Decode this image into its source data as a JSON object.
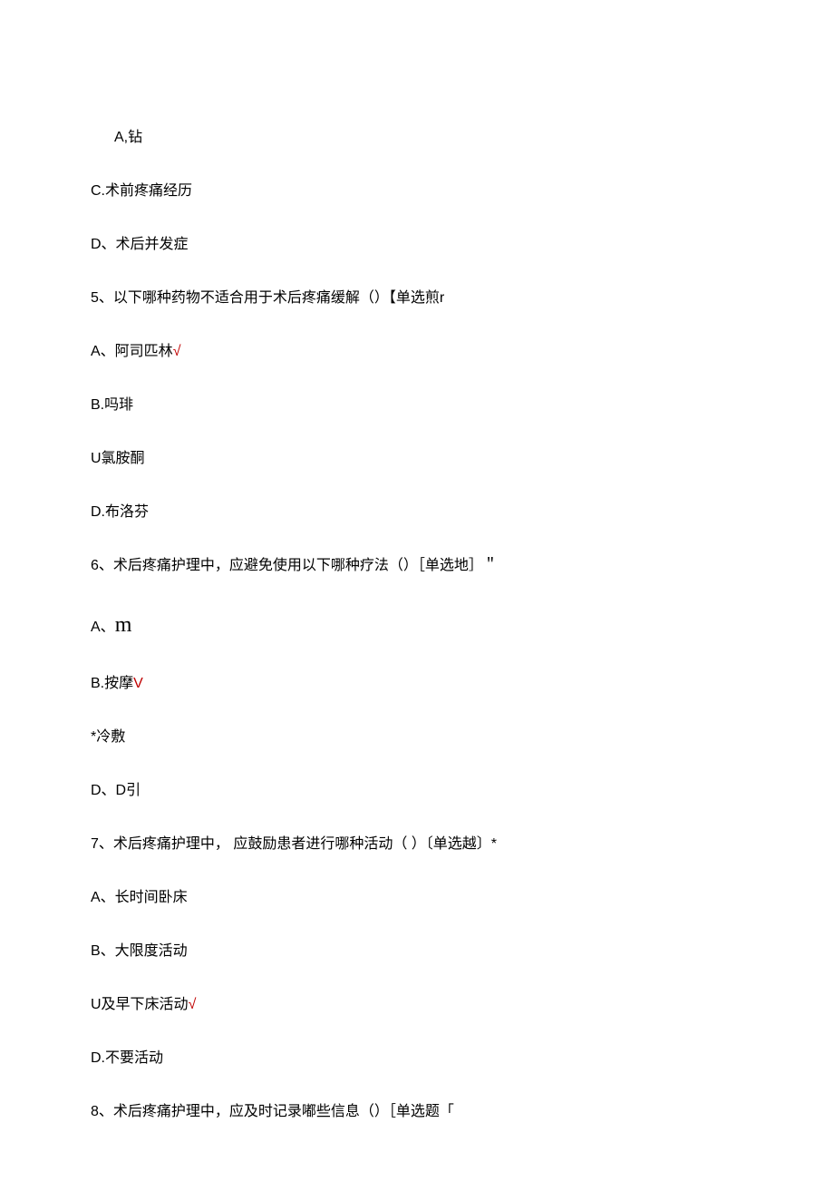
{
  "lines": {
    "l1": "A,钻",
    "l2": "C.术前疼痛经历",
    "l3": "D、术后并发症",
    "q5": "5、以下哪种药物不适合用于术后疼痛缓解（）【单选煎r",
    "q5a_text": "A、阿司匹林",
    "q5a_mark": "√",
    "q5b": "B.吗琲",
    "q5c": "U氯胺酮",
    "q5d": "D.布洛芬",
    "q6": "6、术后疼痛护理中，应避免使用以下哪种疗法（）［单选地］＂",
    "q6a": "A、m",
    "q6a_prefix": "A、",
    "q6a_m": "m",
    "q6b_text": "B.按摩",
    "q6b_mark": "V",
    "q6c": "*冷敷",
    "q6d": "D、D引",
    "q7": "7、术后疼痛护理中， 应鼓励患者进行哪种活动（ ）〔单选越〕*",
    "q7a": "A、长时间卧床",
    "q7b": "B、大限度活动",
    "q7c_text": "U及早下床活动",
    "q7c_mark": "√",
    "q7d": "D.不要活动",
    "q8": "8、术后疼痛护理中，应及时记录嘟些信息（）［单选题「"
  }
}
